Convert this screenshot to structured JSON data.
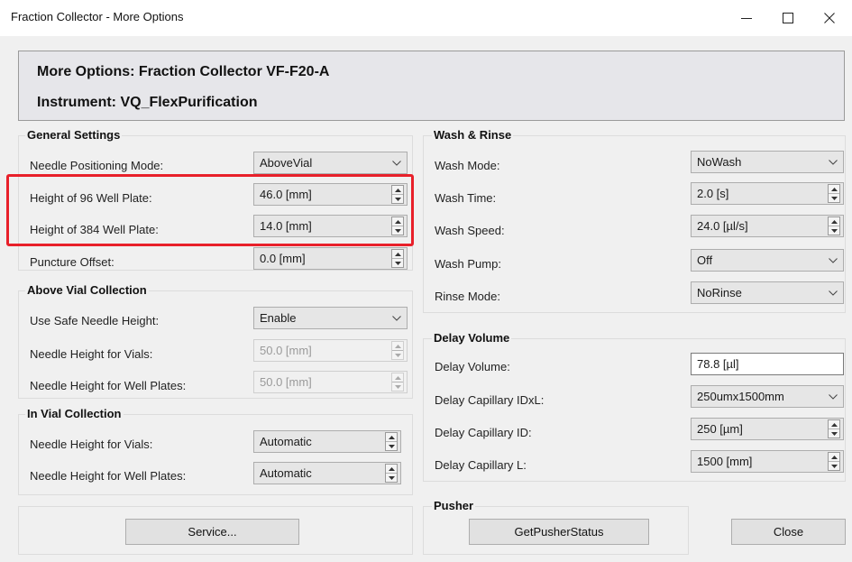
{
  "window": {
    "title": "Fraction Collector - More Options",
    "minimize_icon": "minimize-icon",
    "maximize_icon": "maximize-icon",
    "close_icon": "close-icon"
  },
  "header": {
    "line1": "More Options: Fraction Collector VF-F20-A",
    "line2": "Instrument: VQ_FlexPurification"
  },
  "general": {
    "title": "General Settings",
    "needle_mode_label": "Needle Positioning Mode:",
    "needle_mode_value": "AboveVial",
    "h96_label": "Height of 96 Well Plate:",
    "h96_value": "46.0 [mm]",
    "h384_label": "Height of 384 Well Plate:",
    "h384_value": "14.0 [mm]",
    "puncture_label": "Puncture Offset:",
    "puncture_value": "0.0 [mm]"
  },
  "above_vial": {
    "title": "Above Vial Collection",
    "safe_label": "Use Safe Needle Height:",
    "safe_value": "Enable",
    "vials_label": "Needle Height for Vials:",
    "vials_value": "50.0 [mm]",
    "plates_label": "Needle Height for Well Plates:",
    "plates_value": "50.0 [mm]"
  },
  "in_vial": {
    "title": "In Vial Collection",
    "vials_label": "Needle Height for Vials:",
    "vials_value": "Automatic",
    "plates_label": "Needle Height for Well Plates:",
    "plates_value": "Automatic"
  },
  "wash": {
    "title": "Wash & Rinse",
    "mode_label": "Wash Mode:",
    "mode_value": "NoWash",
    "time_label": "Wash Time:",
    "time_value": "2.0 [s]",
    "speed_label": "Wash Speed:",
    "speed_value": "24.0 [µl/s]",
    "pump_label": "Wash Pump:",
    "pump_value": "Off",
    "rinse_label": "Rinse Mode:",
    "rinse_value": "NoRinse"
  },
  "delay": {
    "title": "Delay Volume",
    "volume_label": "Delay Volume:",
    "volume_value": "78.8 [µl]",
    "idxl_label": "Delay Capillary IDxL:",
    "idxl_value": "250umx1500mm",
    "id_label": "Delay Capillary ID:",
    "id_value": "250 [µm]",
    "l_label": "Delay Capillary L:",
    "l_value": "1500 [mm]"
  },
  "pusher": {
    "title": "Pusher",
    "button": "GetPusherStatus"
  },
  "buttons": {
    "service": "Service...",
    "close": "Close"
  },
  "colors": {
    "highlight": "#e8202a",
    "header_bg": "#e6e6ea",
    "window_bg": "#f0f0f0"
  }
}
